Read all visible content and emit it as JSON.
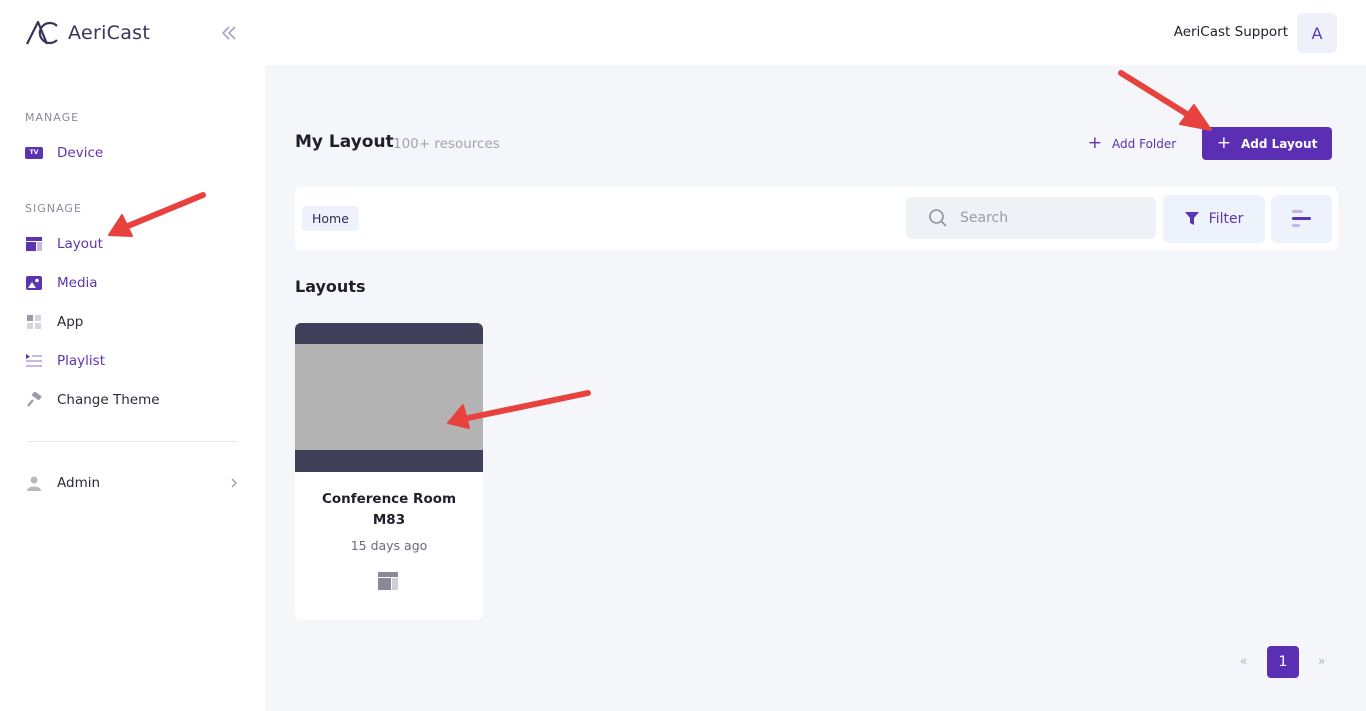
{
  "app": {
    "name": "AeriCast"
  },
  "sidebar": {
    "sections": [
      {
        "label": "MANAGE"
      },
      {
        "label": "SIGNAGE"
      }
    ],
    "items": [
      {
        "label": "Device",
        "icon": "tv-icon"
      },
      {
        "label": "Layout",
        "icon": "layout-icon"
      },
      {
        "label": "Media",
        "icon": "image-icon"
      },
      {
        "label": "App",
        "icon": "apps-grid-icon"
      },
      {
        "label": "Playlist",
        "icon": "playlist-icon"
      },
      {
        "label": "Change Theme",
        "icon": "paint-roller-icon"
      },
      {
        "label": "Admin",
        "icon": "user-icon"
      }
    ],
    "tv_badge": "TV"
  },
  "topbar": {
    "user_name": "AeriCast Support",
    "avatar_initial": "A"
  },
  "header": {
    "title": "My Layout",
    "subtitle": "100+ resources",
    "add_folder_label": "Add Folder",
    "add_layout_label": "Add Layout"
  },
  "toolbar": {
    "breadcrumb": "Home",
    "search_placeholder": "Search",
    "filter_label": "Filter"
  },
  "content": {
    "section_title": "Layouts",
    "layouts": [
      {
        "name": "Conference Room M83",
        "modified": "15 days ago"
      }
    ]
  },
  "pagination": {
    "prev": "«",
    "current": "1",
    "next": "»"
  },
  "colors": {
    "accent": "#5b2fb4",
    "annotation_arrow": "#e8423f"
  }
}
